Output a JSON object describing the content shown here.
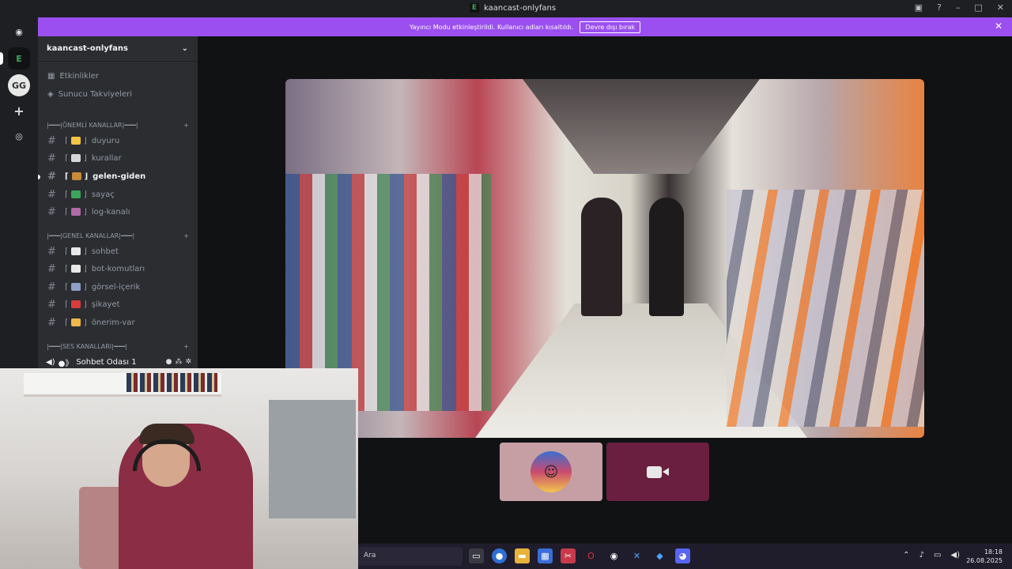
{
  "window": {
    "title": "kaancast-onlyfans"
  },
  "banner": {
    "message": "Yayıncı Modu etkinleştirildi. Kullanıcı adları kısaltıldı.",
    "button_label": "Devre dışı bırak"
  },
  "server": {
    "name": "kaancast-onlyfans"
  },
  "top_items": [
    {
      "label": "Etkinlikler"
    },
    {
      "label": "Sunucu Takviyeleri"
    }
  ],
  "categories": [
    {
      "label": "|━━━|ÖNEMLİ KANALLAR|━━━|"
    },
    {
      "label": "|━━━|GENEL KANALLAR|━━━|"
    },
    {
      "label": "|━━━|SES KANALLARI|━━━|"
    }
  ],
  "channels": [
    {
      "label": "duyuru",
      "emoji": "bell",
      "color": "#f4c542"
    },
    {
      "label": "kurallar",
      "emoji": "page",
      "color": "#d6d6d6"
    },
    {
      "label": "gelen-giden",
      "emoji": "door",
      "color": "#c98a3a"
    },
    {
      "label": "sayaç",
      "emoji": "check",
      "color": "#3ba55c"
    },
    {
      "label": "log-kanalı",
      "emoji": "floppy",
      "color": "#b06aa8"
    },
    {
      "label": "sohbet",
      "emoji": "speech",
      "color": "#e8e8e8"
    },
    {
      "label": "bot-komutları",
      "emoji": "ghost",
      "color": "#e8e8e8"
    },
    {
      "label": "görsel-içerik",
      "emoji": "camera",
      "color": "#8ea0c8"
    },
    {
      "label": "şikayet",
      "emoji": "noentry",
      "color": "#d83c3e"
    },
    {
      "label": "önerim-var",
      "emoji": "hand",
      "color": "#f2b84b"
    }
  ],
  "voice_channel": {
    "label": "Sohbet Odası 1"
  },
  "taskbar": {
    "search_placeholder": "Ara",
    "time": "18:18",
    "date": "26.08.2025"
  },
  "colors": {
    "accent_banner": "#9b4ff0",
    "sidebar_bg": "#2b2d31",
    "server_bar_bg": "#1e1f22"
  }
}
